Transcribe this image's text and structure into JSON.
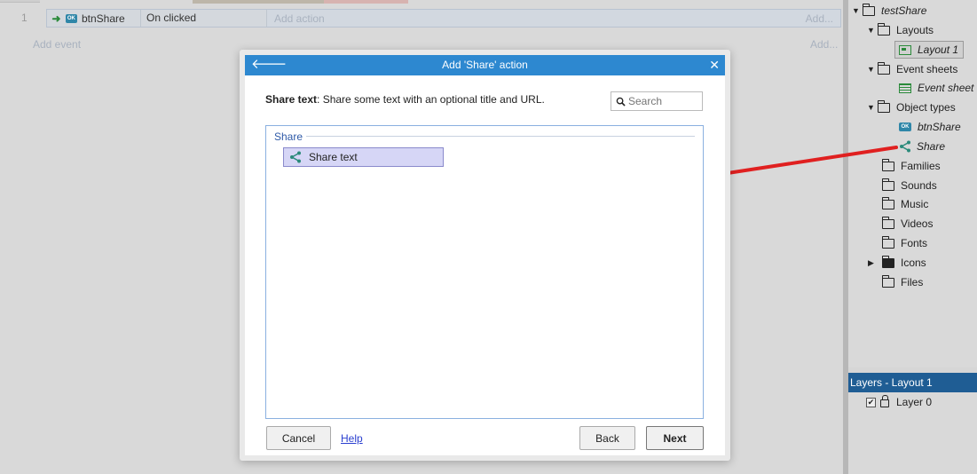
{
  "event_sheet": {
    "event_number": "1",
    "event": {
      "object": "btnShare",
      "trigger": "On clicked",
      "add_action": "Add action",
      "add_right": "Add..."
    },
    "add_event": "Add event",
    "add_right2": "Add..."
  },
  "project_tree": {
    "items": [
      {
        "label": "testShare"
      },
      {
        "label": "Layouts"
      },
      {
        "label": "Layout 1"
      },
      {
        "label": "Event sheets"
      },
      {
        "label": "Event sheet 1"
      },
      {
        "label": "Object types"
      },
      {
        "label": "btnShare"
      },
      {
        "label": "Share"
      },
      {
        "label": "Families"
      },
      {
        "label": "Sounds"
      },
      {
        "label": "Music"
      },
      {
        "label": "Videos"
      },
      {
        "label": "Fonts"
      },
      {
        "label": "Icons"
      },
      {
        "label": "Files"
      }
    ]
  },
  "layers_panel": {
    "title": "Layers - Layout 1",
    "layer": "Layer 0",
    "layer_checked": true,
    "layer_locked": true
  },
  "dialog": {
    "title": "Add 'Share' action",
    "description_bold": "Share text",
    "description_rest": ": Share some text with an optional title and URL.",
    "search_placeholder": "Search",
    "group": "Share",
    "items": [
      {
        "label": "Share text",
        "selected": true
      }
    ],
    "cancel": "Cancel",
    "help": "Help",
    "back": "Back",
    "next": "Next"
  },
  "colors": {
    "title_bar": "#2d88d0",
    "layers_header": "#1f5d94",
    "selection": "#d6d6f6",
    "annotation": "#e02020",
    "share_icon": "#2a8a7a"
  }
}
